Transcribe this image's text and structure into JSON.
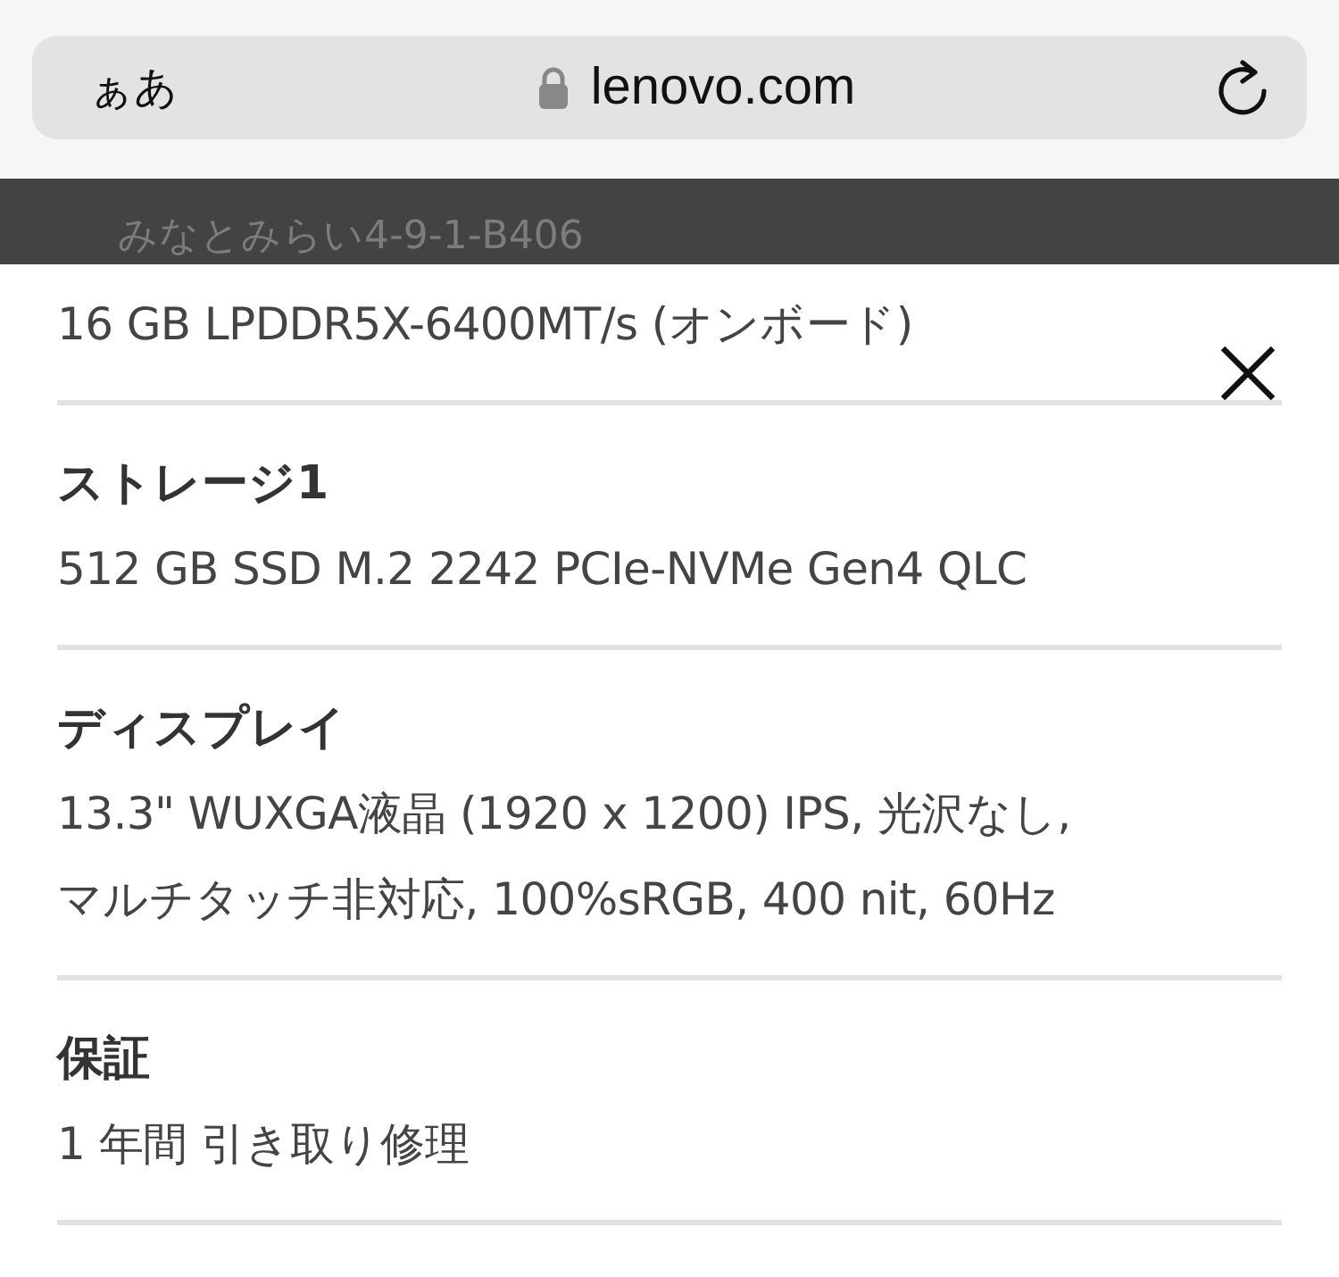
{
  "browser": {
    "text_size_button": "ぁあ",
    "url": "lenovo.com"
  },
  "backdrop": {
    "text": "みなとみらい4-9-1-B406"
  },
  "specs": [
    {
      "lines": [
        "16 GB LPDDR5X-6400MT/s (オンボード)"
      ]
    },
    {
      "label": "ストレージ1",
      "lines": [
        "512 GB SSD M.2 2242 PCIe-NVMe Gen4 QLC"
      ]
    },
    {
      "label": "ディスプレイ",
      "lines": [
        "13.3\" WUXGA液晶 (1920 x 1200) IPS, 光沢なし,",
        "マルチタッチ非対応, 100%sRGB, 400 nit, 60Hz"
      ]
    },
    {
      "label": "保証",
      "lines": [
        "1 年間 引き取り修理"
      ]
    }
  ]
}
